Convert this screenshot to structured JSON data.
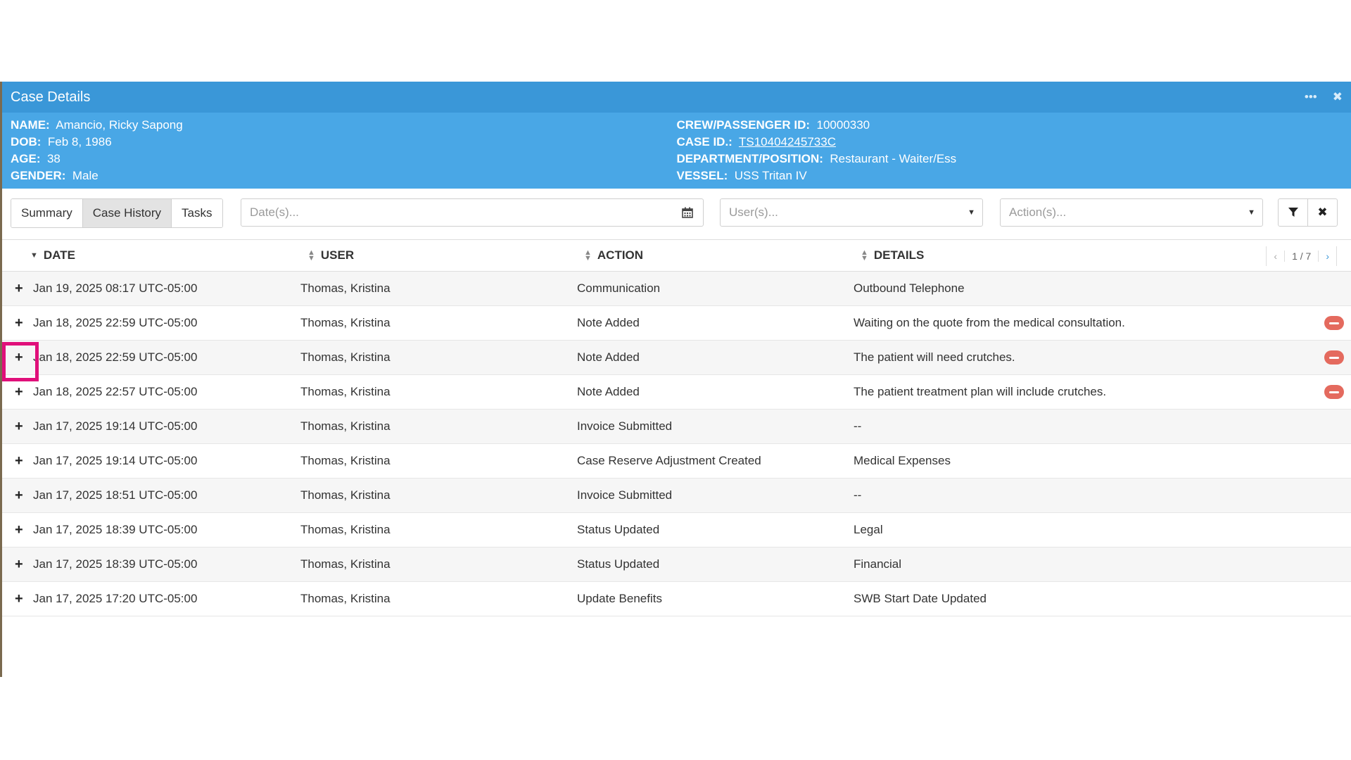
{
  "window": {
    "title": "Case Details",
    "menu_icon": "ellipsis-icon",
    "close_icon": "close-icon"
  },
  "info": {
    "left": [
      {
        "label": "NAME:",
        "value": "Amancio, Ricky Sapong"
      },
      {
        "label": "DOB:",
        "value": "Feb 8, 1986"
      },
      {
        "label": "AGE:",
        "value": "38"
      },
      {
        "label": "GENDER:",
        "value": "Male"
      }
    ],
    "right": [
      {
        "label": "CREW/PASSENGER ID:",
        "value": "10000330"
      },
      {
        "label": "CASE ID.:",
        "value": "TS10404245733C"
      },
      {
        "label": "DEPARTMENT/POSITION:",
        "value": "Restaurant - Waiter/Ess"
      },
      {
        "label": "VESSEL:",
        "value": "USS Tritan IV"
      }
    ]
  },
  "tabs": [
    {
      "label": "Summary",
      "active": false
    },
    {
      "label": "Case History",
      "active": true
    },
    {
      "label": "Tasks",
      "active": false
    }
  ],
  "filters": {
    "date_placeholder": "Date(s)...",
    "users_placeholder": "User(s)...",
    "actions_placeholder": "Action(s)..."
  },
  "table": {
    "columns": [
      "DATE",
      "USER",
      "ACTION",
      "DETAILS"
    ],
    "pager": {
      "prev": "‹",
      "count": "1 / 7",
      "next": "›"
    },
    "rows": [
      {
        "date": "Jan 19, 2025 08:17 UTC-05:00",
        "user": "Thomas, Kristina",
        "action": "Communication",
        "details": "Outbound Telephone",
        "removable": false
      },
      {
        "date": "Jan 18, 2025 22:59 UTC-05:00",
        "user": "Thomas, Kristina",
        "action": "Note Added",
        "details": "Waiting on the quote from the medical consultation.",
        "removable": true
      },
      {
        "date": "Jan 18, 2025 22:59 UTC-05:00",
        "user": "Thomas, Kristina",
        "action": "Note Added",
        "details": "The patient will need crutches.",
        "removable": true
      },
      {
        "date": "Jan 18, 2025 22:57 UTC-05:00",
        "user": "Thomas, Kristina",
        "action": "Note Added",
        "details": "The patient treatment plan will include crutches.",
        "removable": true
      },
      {
        "date": "Jan 17, 2025 19:14 UTC-05:00",
        "user": "Thomas, Kristina",
        "action": "Invoice Submitted",
        "details": "--",
        "removable": false
      },
      {
        "date": "Jan 17, 2025 19:14 UTC-05:00",
        "user": "Thomas, Kristina",
        "action": "Case Reserve Adjustment Created",
        "details": "Medical Expenses",
        "removable": false
      },
      {
        "date": "Jan 17, 2025 18:51 UTC-05:00",
        "user": "Thomas, Kristina",
        "action": "Invoice Submitted",
        "details": "--",
        "removable": false
      },
      {
        "date": "Jan 17, 2025 18:39 UTC-05:00",
        "user": "Thomas, Kristina",
        "action": "Status Updated",
        "details": "Legal",
        "removable": false
      },
      {
        "date": "Jan 17, 2025 18:39 UTC-05:00",
        "user": "Thomas, Kristina",
        "action": "Status Updated",
        "details": "Financial",
        "removable": false
      },
      {
        "date": "Jan 17, 2025 17:20 UTC-05:00",
        "user": "Thomas, Kristina",
        "action": "Update Benefits",
        "details": "SWB Start Date Updated",
        "removable": false
      }
    ]
  },
  "colors": {
    "titlebar": "#3a97d8",
    "infobar": "#49a7e6",
    "remove": "#e46a5e",
    "highlight": "#e0107a"
  }
}
